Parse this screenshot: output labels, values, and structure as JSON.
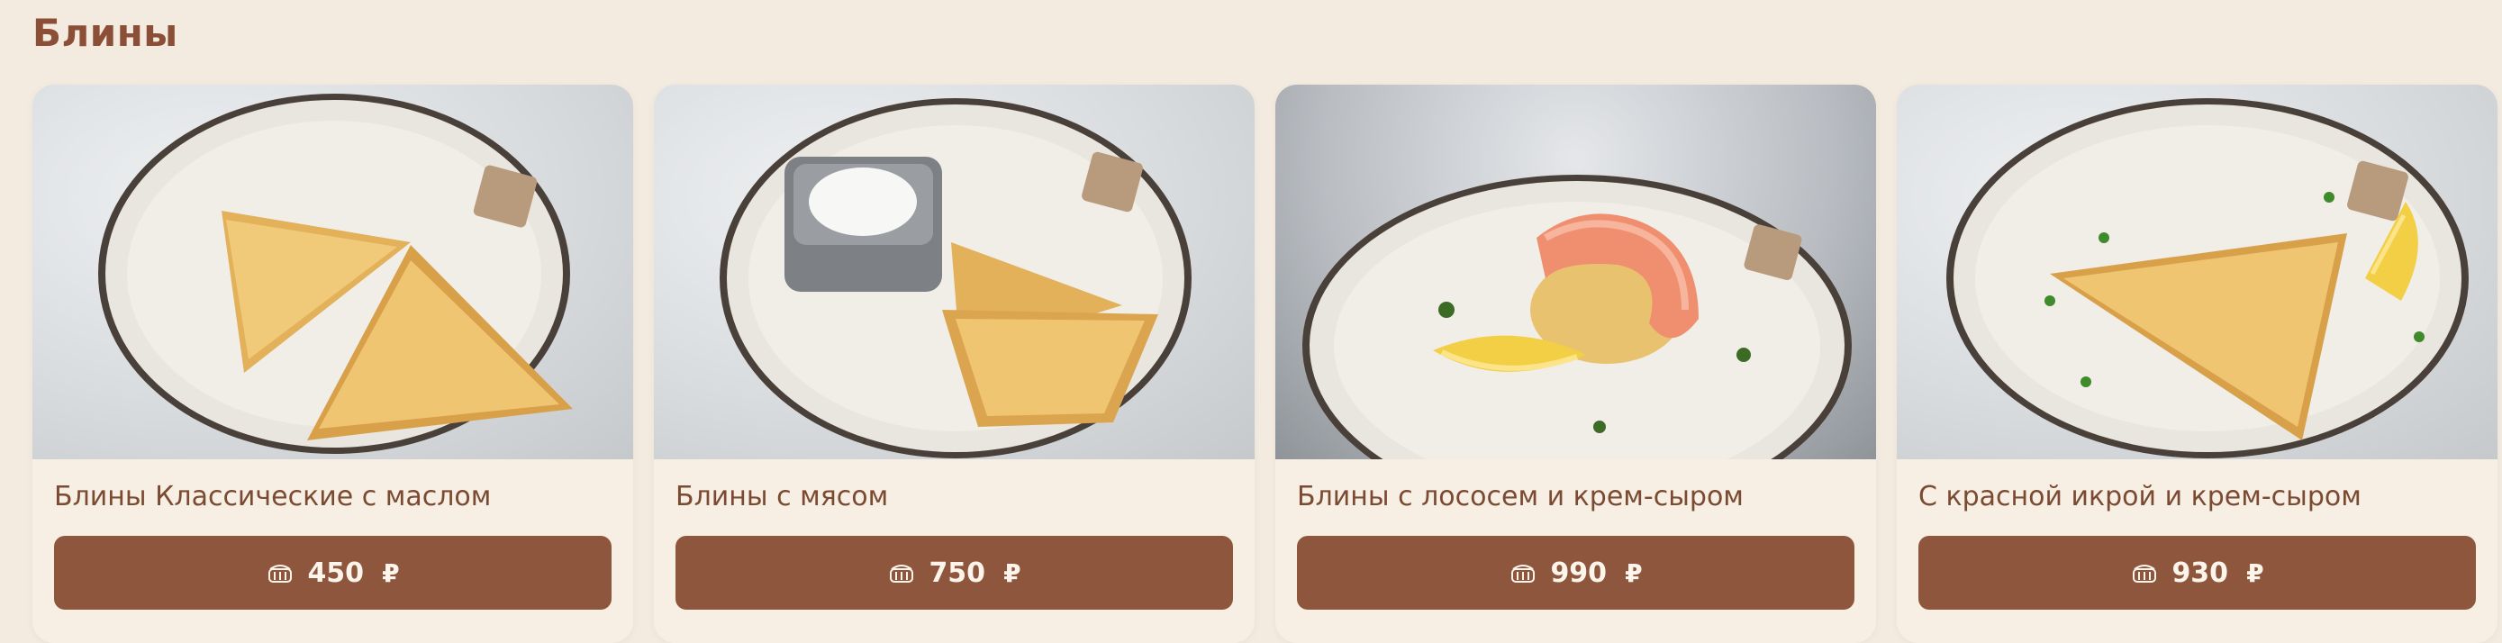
{
  "section": {
    "title": "Блины"
  },
  "icons": {
    "price_button": "basket-icon"
  },
  "colors": {
    "button": "#8e573d",
    "title": "#8a4f36",
    "background": "#f3ebe0",
    "card": "#f7efe3"
  },
  "items": [
    {
      "name": "Блины Классические с маслом",
      "price": "450",
      "currency": "₽"
    },
    {
      "name": "Блины с мясом",
      "price": "750",
      "currency": "₽"
    },
    {
      "name": "Блины с лососем и крем-сыром",
      "price": "990",
      "currency": "₽"
    },
    {
      "name": "С красной икрой и крем-сыром",
      "price": "930",
      "currency": "₽"
    }
  ]
}
